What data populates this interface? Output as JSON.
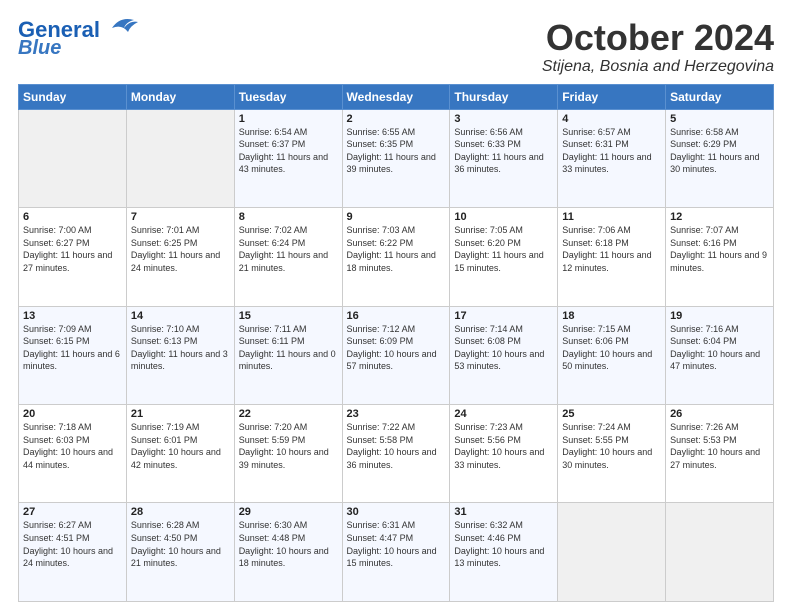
{
  "header": {
    "logo_line1": "General",
    "logo_line2": "Blue",
    "month_title": "October 2024",
    "location": "Stijena, Bosnia and Herzegovina"
  },
  "weekdays": [
    "Sunday",
    "Monday",
    "Tuesday",
    "Wednesday",
    "Thursday",
    "Friday",
    "Saturday"
  ],
  "weeks": [
    [
      {
        "day": "",
        "info": ""
      },
      {
        "day": "",
        "info": ""
      },
      {
        "day": "1",
        "info": "Sunrise: 6:54 AM\nSunset: 6:37 PM\nDaylight: 11 hours and 43 minutes."
      },
      {
        "day": "2",
        "info": "Sunrise: 6:55 AM\nSunset: 6:35 PM\nDaylight: 11 hours and 39 minutes."
      },
      {
        "day": "3",
        "info": "Sunrise: 6:56 AM\nSunset: 6:33 PM\nDaylight: 11 hours and 36 minutes."
      },
      {
        "day": "4",
        "info": "Sunrise: 6:57 AM\nSunset: 6:31 PM\nDaylight: 11 hours and 33 minutes."
      },
      {
        "day": "5",
        "info": "Sunrise: 6:58 AM\nSunset: 6:29 PM\nDaylight: 11 hours and 30 minutes."
      }
    ],
    [
      {
        "day": "6",
        "info": "Sunrise: 7:00 AM\nSunset: 6:27 PM\nDaylight: 11 hours and 27 minutes."
      },
      {
        "day": "7",
        "info": "Sunrise: 7:01 AM\nSunset: 6:25 PM\nDaylight: 11 hours and 24 minutes."
      },
      {
        "day": "8",
        "info": "Sunrise: 7:02 AM\nSunset: 6:24 PM\nDaylight: 11 hours and 21 minutes."
      },
      {
        "day": "9",
        "info": "Sunrise: 7:03 AM\nSunset: 6:22 PM\nDaylight: 11 hours and 18 minutes."
      },
      {
        "day": "10",
        "info": "Sunrise: 7:05 AM\nSunset: 6:20 PM\nDaylight: 11 hours and 15 minutes."
      },
      {
        "day": "11",
        "info": "Sunrise: 7:06 AM\nSunset: 6:18 PM\nDaylight: 11 hours and 12 minutes."
      },
      {
        "day": "12",
        "info": "Sunrise: 7:07 AM\nSunset: 6:16 PM\nDaylight: 11 hours and 9 minutes."
      }
    ],
    [
      {
        "day": "13",
        "info": "Sunrise: 7:09 AM\nSunset: 6:15 PM\nDaylight: 11 hours and 6 minutes."
      },
      {
        "day": "14",
        "info": "Sunrise: 7:10 AM\nSunset: 6:13 PM\nDaylight: 11 hours and 3 minutes."
      },
      {
        "day": "15",
        "info": "Sunrise: 7:11 AM\nSunset: 6:11 PM\nDaylight: 11 hours and 0 minutes."
      },
      {
        "day": "16",
        "info": "Sunrise: 7:12 AM\nSunset: 6:09 PM\nDaylight: 10 hours and 57 minutes."
      },
      {
        "day": "17",
        "info": "Sunrise: 7:14 AM\nSunset: 6:08 PM\nDaylight: 10 hours and 53 minutes."
      },
      {
        "day": "18",
        "info": "Sunrise: 7:15 AM\nSunset: 6:06 PM\nDaylight: 10 hours and 50 minutes."
      },
      {
        "day": "19",
        "info": "Sunrise: 7:16 AM\nSunset: 6:04 PM\nDaylight: 10 hours and 47 minutes."
      }
    ],
    [
      {
        "day": "20",
        "info": "Sunrise: 7:18 AM\nSunset: 6:03 PM\nDaylight: 10 hours and 44 minutes."
      },
      {
        "day": "21",
        "info": "Sunrise: 7:19 AM\nSunset: 6:01 PM\nDaylight: 10 hours and 42 minutes."
      },
      {
        "day": "22",
        "info": "Sunrise: 7:20 AM\nSunset: 5:59 PM\nDaylight: 10 hours and 39 minutes."
      },
      {
        "day": "23",
        "info": "Sunrise: 7:22 AM\nSunset: 5:58 PM\nDaylight: 10 hours and 36 minutes."
      },
      {
        "day": "24",
        "info": "Sunrise: 7:23 AM\nSunset: 5:56 PM\nDaylight: 10 hours and 33 minutes."
      },
      {
        "day": "25",
        "info": "Sunrise: 7:24 AM\nSunset: 5:55 PM\nDaylight: 10 hours and 30 minutes."
      },
      {
        "day": "26",
        "info": "Sunrise: 7:26 AM\nSunset: 5:53 PM\nDaylight: 10 hours and 27 minutes."
      }
    ],
    [
      {
        "day": "27",
        "info": "Sunrise: 6:27 AM\nSunset: 4:51 PM\nDaylight: 10 hours and 24 minutes."
      },
      {
        "day": "28",
        "info": "Sunrise: 6:28 AM\nSunset: 4:50 PM\nDaylight: 10 hours and 21 minutes."
      },
      {
        "day": "29",
        "info": "Sunrise: 6:30 AM\nSunset: 4:48 PM\nDaylight: 10 hours and 18 minutes."
      },
      {
        "day": "30",
        "info": "Sunrise: 6:31 AM\nSunset: 4:47 PM\nDaylight: 10 hours and 15 minutes."
      },
      {
        "day": "31",
        "info": "Sunrise: 6:32 AM\nSunset: 4:46 PM\nDaylight: 10 hours and 13 minutes."
      },
      {
        "day": "",
        "info": ""
      },
      {
        "day": "",
        "info": ""
      }
    ]
  ]
}
